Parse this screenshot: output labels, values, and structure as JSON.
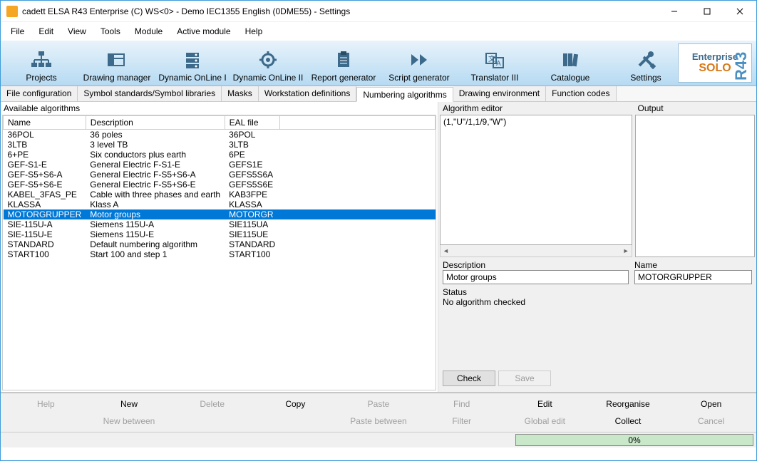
{
  "window": {
    "title": "cadett ELSA R43 Enterprise (C) WS<0> - Demo IEC1355 English (0DME55) - Settings"
  },
  "menu": [
    "File",
    "Edit",
    "View",
    "Tools",
    "Module",
    "Active module",
    "Help"
  ],
  "toolbar": [
    {
      "label": "Projects",
      "icon": "hierarchy"
    },
    {
      "label": "Drawing manager",
      "icon": "layers"
    },
    {
      "label": "Dynamic OnLine I",
      "icon": "server"
    },
    {
      "label": "Dynamic OnLine II",
      "icon": "gear"
    },
    {
      "label": "Report generator",
      "icon": "clipboard"
    },
    {
      "label": "Script generator",
      "icon": "play"
    },
    {
      "label": "Translator III",
      "icon": "translate"
    },
    {
      "label": "Catalogue",
      "icon": "books"
    },
    {
      "label": "Settings",
      "icon": "tools"
    }
  ],
  "brand": {
    "line1": "Enterprise",
    "line2": "SOLO",
    "side": "R43"
  },
  "subtabs": [
    "File configuration",
    "Symbol standards/Symbol libraries",
    "Masks",
    "Workstation definitions",
    "Numbering algorithms",
    "Drawing environment",
    "Function codes"
  ],
  "active_subtab": 4,
  "left": {
    "title": "Available algorithms",
    "columns": [
      "Name",
      "Description",
      "EAL file"
    ],
    "rows": [
      {
        "name": "36POL",
        "desc": "36 poles",
        "eal": "36POL"
      },
      {
        "name": "3LTB",
        "desc": "3 level TB",
        "eal": "3LTB"
      },
      {
        "name": "6+PE",
        "desc": "Six conductors plus earth",
        "eal": "6PE"
      },
      {
        "name": "GEF-S1-E",
        "desc": "General Electric F-S1-E",
        "eal": "GEFS1E"
      },
      {
        "name": "GEF-S5+S6-A",
        "desc": "General Electric F-S5+S6-A",
        "eal": "GEFS5S6A"
      },
      {
        "name": "GEF-S5+S6-E",
        "desc": "General Electric F-S5+S6-E",
        "eal": "GEFS5S6E"
      },
      {
        "name": "KABEL_3FAS_PE",
        "desc": "Cable with three phases and earth",
        "eal": "KAB3FPE"
      },
      {
        "name": "KLASSA",
        "desc": "Klass A",
        "eal": "KLASSA"
      },
      {
        "name": "MOTORGRUPPER",
        "desc": "Motor groups",
        "eal": "MOTORGR",
        "selected": true
      },
      {
        "name": "SIE-115U-A",
        "desc": "Siemens 115U-A",
        "eal": "SIE115UA"
      },
      {
        "name": "SIE-115U-E",
        "desc": "Siemens 115U-E",
        "eal": "SIE115UE"
      },
      {
        "name": "STANDARD",
        "desc": "Default numbering algorithm",
        "eal": "STANDARD"
      },
      {
        "name": "START100",
        "desc": "Start 100 and step 1",
        "eal": "START100"
      }
    ]
  },
  "right": {
    "editor_label": "Algorithm editor",
    "output_label": "Output",
    "editor_text": "(1,\"U\"/1,1/9,\"W\")",
    "desc_label": "Description",
    "name_label": "Name",
    "desc_value": "Motor groups",
    "name_value": "MOTORGRUPPER",
    "status_label": "Status",
    "status_text": "No algorithm checked",
    "check_btn": "Check",
    "save_btn": "Save"
  },
  "bottom": {
    "row1": [
      "Help",
      "New",
      "Delete",
      "Copy",
      "Paste",
      "Find",
      "Edit",
      "Reorganise",
      "Open"
    ],
    "row1_enabled": [
      false,
      true,
      false,
      true,
      false,
      false,
      true,
      true,
      true
    ],
    "row2": [
      "",
      "New between",
      "",
      "",
      "Paste between",
      "Filter",
      "Global edit",
      "Collect",
      "Cancel"
    ],
    "row2_enabled": [
      false,
      false,
      false,
      false,
      false,
      false,
      false,
      true,
      false
    ]
  },
  "progress": "0%"
}
